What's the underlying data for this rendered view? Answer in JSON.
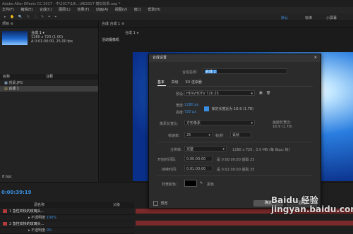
{
  "app": {
    "title": "Adobe After Effects CC 2017 - 中\\2017\\18\\...\\AE2017 模拟效果.aep *"
  },
  "menu": [
    "文件(F)",
    "编辑(E)",
    "合成(C)",
    "图层(L)",
    "效果(T)",
    "动画(A)",
    "视图(V)",
    "窗口",
    "帮助(H)"
  ],
  "workspaces": {
    "default": "默认",
    "active": "标准",
    "small": "小屏幕"
  },
  "project": {
    "comp_name": "合成 1 ▾",
    "comp_size": "1280 x 720 (1.00)",
    "comp_duration": "Δ 0:01:00:00, 25.00 fps",
    "col_name": "名称",
    "col_comment": "注释",
    "items": [
      {
        "name": "背景.JPG"
      },
      {
        "name": "合成 1"
      }
    ],
    "bpc": "8 bpc"
  },
  "viewer": {
    "tab": "合成 合成 1 ≡",
    "sub": "活动摄像机",
    "view_label": "合成 1 ◂"
  },
  "timeline": {
    "timecode": "0:00:39:19",
    "col_source": "源名称",
    "col_parent": "父级",
    "rows": [
      {
        "num": "1",
        "name": "急性欢快的玫瑰头..."
      },
      {
        "num": "",
        "name": "▸ 不透明度",
        "value": "100%"
      },
      {
        "num": "2",
        "name": "急性欢快的玫瑰头..."
      },
      {
        "num": "",
        "name": "▸ 不透明度",
        "value": "0%"
      }
    ]
  },
  "dialog": {
    "title": "合成设置",
    "close": "✕",
    "name_label": "合成名称:",
    "name_value": "合成 2",
    "tabs": [
      "基本",
      "高级",
      "3D 渲染器"
    ],
    "preset_label": "预设:",
    "preset_value": "HDV/HDTV 720 25",
    "width_label": "宽度:",
    "width_value": "1280 px",
    "height_label": "高度:",
    "height_value": "720 px",
    "lock_label": "锁定长宽比为 16:9 (1.78)",
    "par_label": "像素长宽比:",
    "par_value": "方形像素",
    "frame_aspect_label": "画面长宽比:",
    "frame_aspect_value": "16:9 (1.78)",
    "fps_label": "帧速率:",
    "fps_value": "25",
    "fps_unit": "帧/秒",
    "drop_frame": "丢帧",
    "res_label": "分辨率:",
    "res_value": "完整",
    "res_info": "1280 x 720 , 3.5 MB (每 8bpc 帧)",
    "start_label": "开始时间码:",
    "start_value": "0:00:00:00",
    "start_info": "是 0:00:00:00 基础 25",
    "dur_label": "持续时间:",
    "dur_value": "0:01:00:00",
    "dur_info": "是 0:01:00:00 基础 25",
    "bg_label": "背景颜色:",
    "bg_name": "黑色",
    "preview_label": "预览",
    "ok": "确定",
    "cancel": "取消"
  },
  "watermark": "Baidu 经验\njingyan.baidu.com"
}
